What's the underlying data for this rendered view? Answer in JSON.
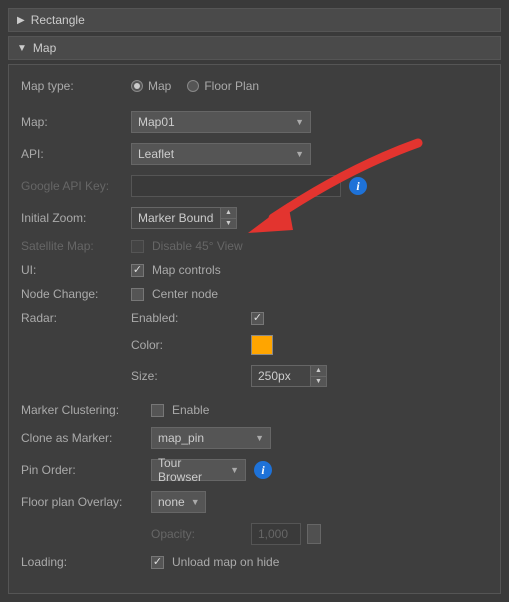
{
  "sections": {
    "rectangle": {
      "title": "Rectangle",
      "expanded": false
    },
    "map": {
      "title": "Map",
      "expanded": true
    }
  },
  "map_type": {
    "label": "Map type:",
    "options": {
      "map": "Map",
      "floor_plan": "Floor Plan"
    },
    "selected": "map"
  },
  "map_select": {
    "label": "Map:",
    "value": "Map01"
  },
  "api": {
    "label": "API:",
    "value": "Leaflet"
  },
  "google_key": {
    "label": "Google API Key:",
    "value": ""
  },
  "initial_zoom": {
    "label": "Initial Zoom:",
    "value": "Marker Bounds"
  },
  "satellite": {
    "label": "Satellite Map:",
    "checkbox_label": "Disable 45° View"
  },
  "ui": {
    "label": "UI:",
    "checkbox_label": "Map controls",
    "checked": true
  },
  "node_change": {
    "label": "Node Change:",
    "checkbox_label": "Center node",
    "checked": false
  },
  "radar": {
    "label": "Radar:",
    "enabled": {
      "label": "Enabled:",
      "checked": true
    },
    "color": {
      "label": "Color:",
      "value": "#ffa500"
    },
    "size": {
      "label": "Size:",
      "value": "250px"
    }
  },
  "clustering": {
    "label": "Marker Clustering:",
    "checkbox_label": "Enable",
    "checked": false
  },
  "clone_marker": {
    "label": "Clone as Marker:",
    "value": "map_pin"
  },
  "pin_order": {
    "label": "Pin Order:",
    "value": "Tour Browser"
  },
  "overlay": {
    "label": "Floor plan Overlay:",
    "value": "none"
  },
  "opacity": {
    "label": "Opacity:",
    "value": "1,000"
  },
  "loading": {
    "label": "Loading:",
    "checkbox_label": "Unload map on hide",
    "checked": true
  }
}
